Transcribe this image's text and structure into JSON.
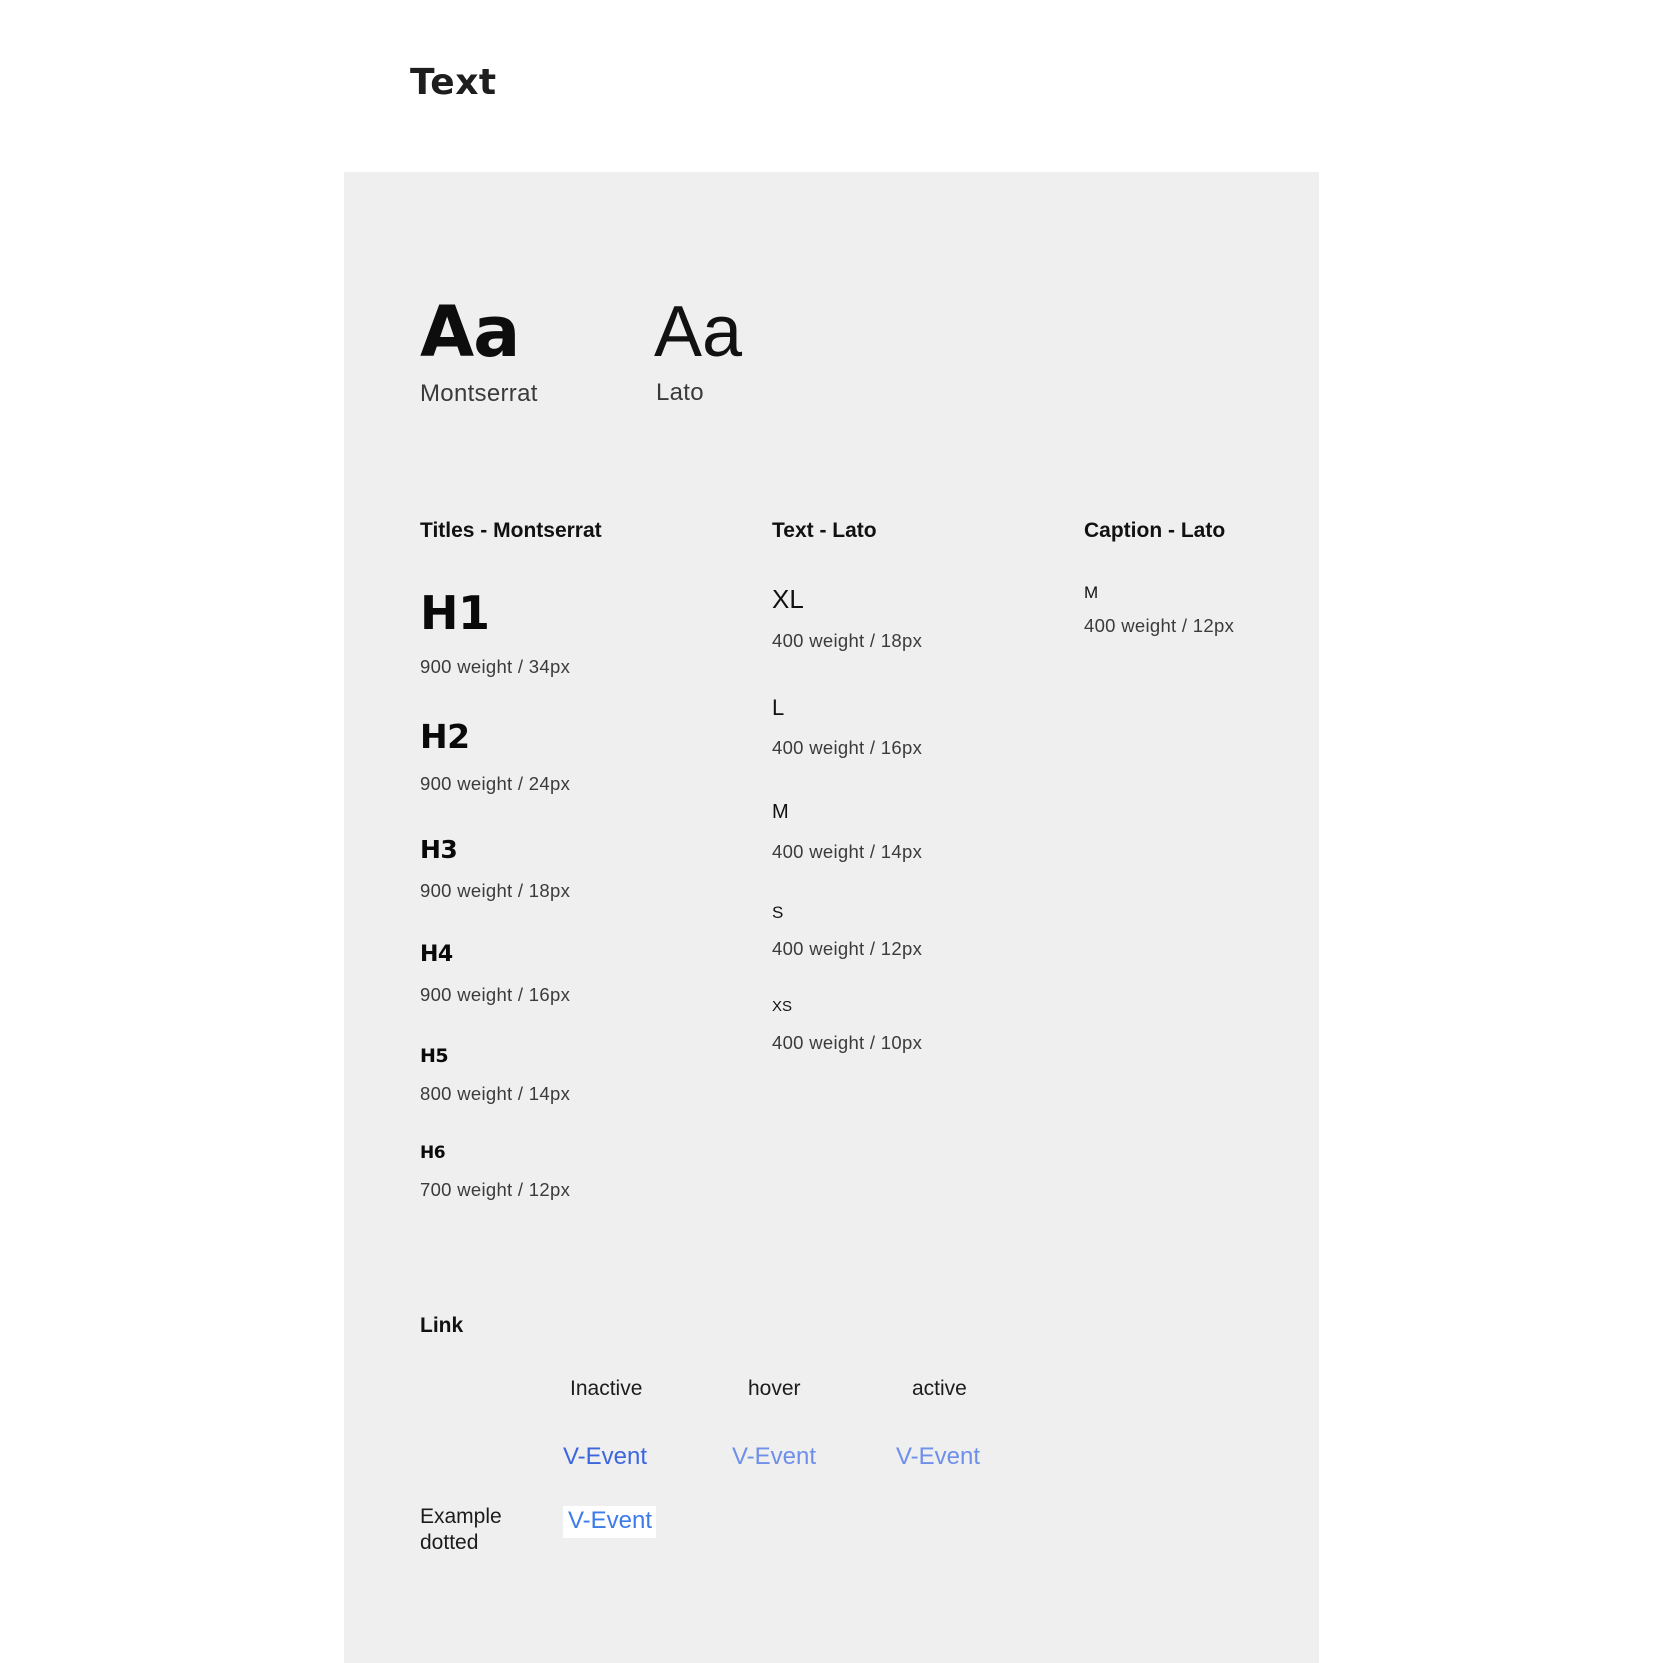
{
  "page": {
    "title": "Text"
  },
  "fonts": [
    {
      "sample": "Aa",
      "name": "Montserrat"
    },
    {
      "sample": "Aa",
      "name": "Lato"
    }
  ],
  "titles": {
    "heading": "Titles - Montserrat",
    "items": [
      {
        "label": "H1",
        "spec": "900 weight / 34px"
      },
      {
        "label": "H2",
        "spec": "900 weight / 24px"
      },
      {
        "label": "H3",
        "spec": "900 weight / 18px"
      },
      {
        "label": "H4",
        "spec": "900 weight / 16px"
      },
      {
        "label": "H5",
        "spec": "800 weight / 14px"
      },
      {
        "label": "H6",
        "spec": "700 weight / 12px"
      }
    ]
  },
  "text": {
    "heading": "Text - Lato",
    "items": [
      {
        "label": "XL",
        "spec": "400 weight / 18px"
      },
      {
        "label": "L",
        "spec": "400 weight / 16px"
      },
      {
        "label": "M",
        "spec": "400 weight / 14px"
      },
      {
        "label": "S",
        "spec": "400 weight / 12px"
      },
      {
        "label": "XS",
        "spec": "400 weight / 10px"
      }
    ]
  },
  "caption": {
    "heading": "Caption - Lato",
    "items": [
      {
        "label": "M",
        "spec": "400 weight / 12px"
      }
    ]
  },
  "link": {
    "heading": "Link",
    "states": [
      "Inactive",
      "hover",
      "active"
    ],
    "sample": "V-Event",
    "example_label_line1": "Example",
    "example_label_line2": "dotted",
    "example_sample": "V-Event",
    "colors": {
      "inactive": "#3c66de",
      "hover": "#6e8fea",
      "active": "#6e8fea",
      "dotted": "#3c7bea"
    }
  }
}
